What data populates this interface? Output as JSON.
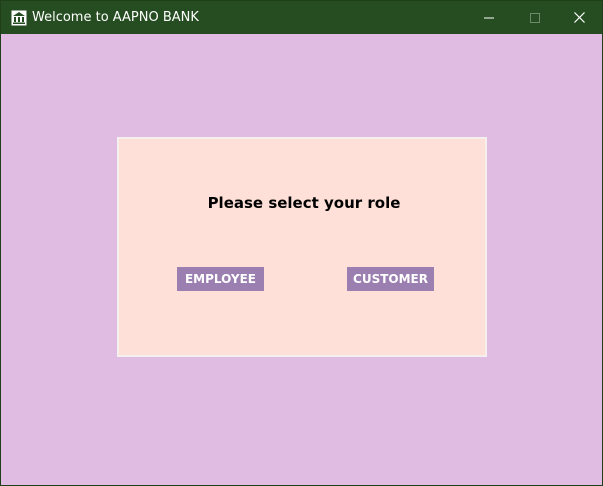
{
  "window": {
    "title": "Welcome to AAPNO BANK",
    "icon": "bank-icon",
    "controls": [
      "minimize-icon",
      "maximize-icon",
      "close-icon"
    ]
  },
  "colors": {
    "titlebar": "#264d21",
    "background": "#e0bce3",
    "panel": "#fee0d8",
    "button": "#9b7fb0",
    "button_text": "#ffffff"
  },
  "main": {
    "prompt": "Please select your role",
    "buttons": {
      "employee": "EMPLOYEE",
      "customer": "CUSTOMER"
    }
  }
}
